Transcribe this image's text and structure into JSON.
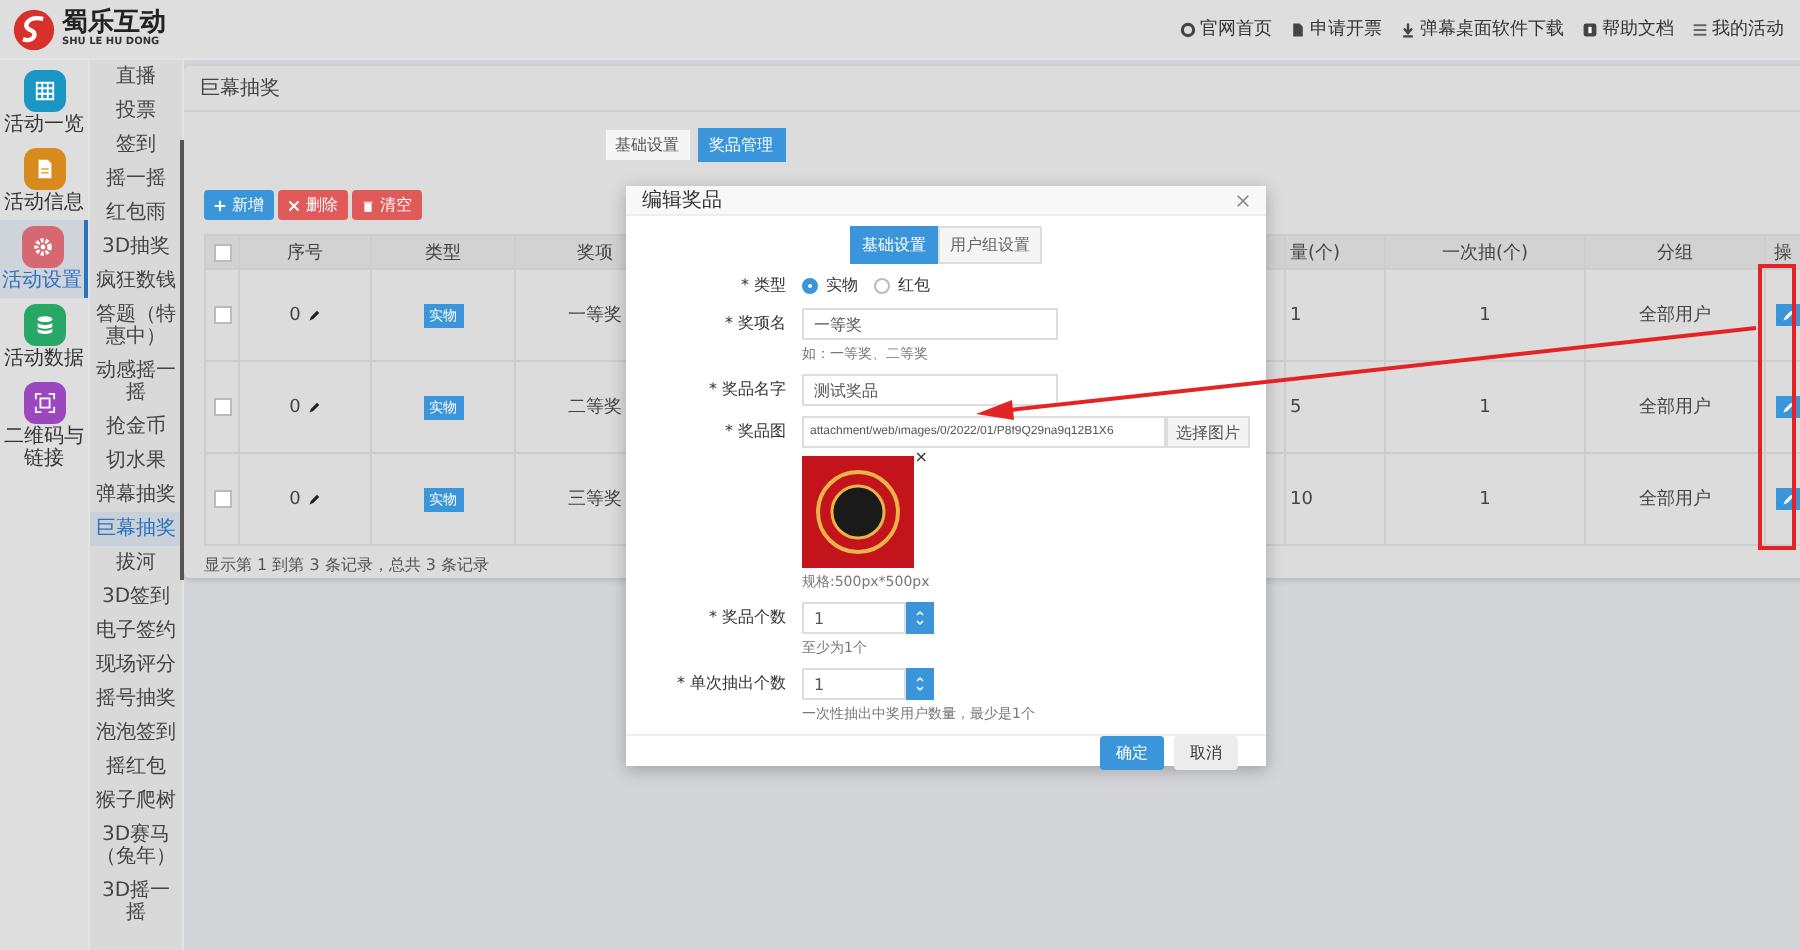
{
  "logo": {
    "name": "蜀乐互动",
    "subtitle": "SHU LE HU DONG"
  },
  "top_links": [
    {
      "label": "官网首页",
      "kind": "home"
    },
    {
      "label": "申请开票",
      "kind": "invoice"
    },
    {
      "label": "弹幕桌面软件下载",
      "kind": "download"
    },
    {
      "label": "帮助文档",
      "kind": "help"
    },
    {
      "label": "我的活动",
      "kind": "list"
    }
  ],
  "nav": [
    {
      "label": "活动一览",
      "selected": false,
      "color": "#1a96c4"
    },
    {
      "label": "活动信息",
      "selected": false,
      "color": "#d98a1c"
    },
    {
      "label": "活动设置",
      "selected": true,
      "color": "#d66872"
    },
    {
      "label": "活动数据",
      "selected": false,
      "color": "#27a866"
    },
    {
      "label": "二维码与链接",
      "selected": false,
      "color": "#9c46c0"
    }
  ],
  "subnav": [
    {
      "label": "直播",
      "selected": false
    },
    {
      "label": "投票",
      "selected": false
    },
    {
      "label": "签到",
      "selected": false
    },
    {
      "label": "摇一摇",
      "selected": false
    },
    {
      "label": "红包雨",
      "selected": false
    },
    {
      "label": "3D抽奖",
      "selected": false
    },
    {
      "label": "疯狂数钱",
      "selected": false
    },
    {
      "label": "答题（特惠中）",
      "selected": false
    },
    {
      "label": "动感摇一摇",
      "selected": false
    },
    {
      "label": "抢金币",
      "selected": false
    },
    {
      "label": "切水果",
      "selected": false
    },
    {
      "label": "弹幕抽奖",
      "selected": false
    },
    {
      "label": "巨幕抽奖",
      "selected": true
    },
    {
      "label": "拔河",
      "selected": false
    },
    {
      "label": "3D签到",
      "selected": false
    },
    {
      "label": "电子签约",
      "selected": false
    },
    {
      "label": "现场评分",
      "selected": false
    },
    {
      "label": "摇号抽奖",
      "selected": false
    },
    {
      "label": "泡泡签到",
      "selected": false
    },
    {
      "label": "摇红包",
      "selected": false
    },
    {
      "label": "猴子爬树",
      "selected": false
    },
    {
      "label": "3D赛马（兔年）",
      "selected": false
    },
    {
      "label": "3D摇一摇",
      "selected": false
    }
  ],
  "panel": {
    "title": "巨幕抽奖",
    "tabs": [
      {
        "label": "基础设置",
        "selected": false
      },
      {
        "label": "奖品管理",
        "selected": true
      }
    ],
    "toolbar": [
      {
        "label": "新增",
        "kind": "add"
      },
      {
        "label": "删除",
        "kind": "delete"
      },
      {
        "label": "清空",
        "kind": "clear"
      }
    ],
    "table": {
      "header_checked": false,
      "columns": [
        "序号",
        "类型",
        "奖项",
        "量(个)",
        "一次抽(个)",
        "分组",
        "操"
      ],
      "rows": [
        {
          "checked": false,
          "seq": "0",
          "type": "实物",
          "prize": "一等奖",
          "count": "1",
          "once": "1",
          "group": "全部用户"
        },
        {
          "checked": false,
          "seq": "0",
          "type": "实物",
          "prize": "二等奖",
          "count": "5",
          "once": "1",
          "group": "全部用户"
        },
        {
          "checked": false,
          "seq": "0",
          "type": "实物",
          "prize": "三等奖",
          "count": "10",
          "once": "1",
          "group": "全部用户"
        }
      ]
    },
    "footer": "显示第 1 到第 3 条记录，总共 3 条记录"
  },
  "modal": {
    "title": "编辑奖品",
    "tabs": [
      {
        "label": "基础设置",
        "selected": true
      },
      {
        "label": "用户组设置",
        "selected": false
      }
    ],
    "fields": [
      {
        "kind": "radio",
        "label": "* 类型",
        "options": [
          {
            "label": "实物",
            "selected": true
          },
          {
            "label": "红包",
            "selected": false
          }
        ]
      },
      {
        "kind": "text",
        "label": "* 奖项名",
        "value": "一等奖",
        "hint": "如：一等奖、二等奖"
      },
      {
        "kind": "text",
        "label": "* 奖品名字",
        "value": "测试奖品"
      },
      {
        "kind": "image",
        "label": "* 奖品图",
        "value": "attachment/web/images/0/2022/01/P8f9Q29na9q12B1X6",
        "button": "选择图片",
        "remove": "×",
        "hint": "规格:500px*500px"
      },
      {
        "kind": "number",
        "label": "* 奖品个数",
        "value": "1",
        "hint": "至少为1个"
      },
      {
        "kind": "number",
        "label": "* 单次抽出个数",
        "value": "1",
        "hint": "一次性抽出中奖用户数量，最少是1个"
      }
    ],
    "buttons": [
      {
        "label": "确定",
        "kind": "primary"
      },
      {
        "label": "取消",
        "kind": "default"
      }
    ]
  }
}
